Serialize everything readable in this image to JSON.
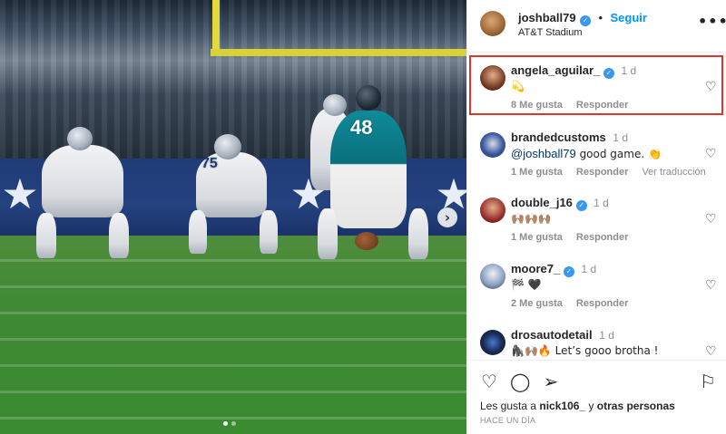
{
  "post": {
    "author": "joshball79",
    "follow_label": "Seguir",
    "location": "AT&T Stadium",
    "more_icon": "more-icon",
    "photo": {
      "description_jersey_numbers": [
        "75",
        "48"
      ],
      "carousel_index": 1,
      "carousel_total": 2
    }
  },
  "comments": [
    {
      "user": "angela_aguilar_",
      "verified": true,
      "time": "1 d",
      "text": "💫",
      "likes": "8 Me gusta",
      "reply": "Responder",
      "translate": "",
      "highlighted": true
    },
    {
      "user": "brandedcustoms",
      "verified": false,
      "time": "1 d",
      "mention": "@joshball79",
      "text": " good game. 👏",
      "likes": "1 Me gusta",
      "reply": "Responder",
      "translate": "Ver traducción",
      "highlighted": false
    },
    {
      "user": "double_j16",
      "verified": true,
      "time": "1 d",
      "text": "🙌🏽🙌🏽🙌🏽",
      "likes": "1 Me gusta",
      "reply": "Responder",
      "translate": "",
      "highlighted": false
    },
    {
      "user": "moore7_",
      "verified": true,
      "time": "1 d",
      "text": "🏁 🖤",
      "likes": "2 Me gusta",
      "reply": "Responder",
      "translate": "",
      "highlighted": false
    },
    {
      "user": "drosautodetail",
      "verified": false,
      "time": "1 d",
      "text": "🦍🙌🏽🔥 Let’s gooo brotha !",
      "likes": "",
      "reply": "",
      "translate": "",
      "highlighted": false
    }
  ],
  "footer": {
    "likes_prefix": "Les gusta a ",
    "likes_user": "nick106_",
    "likes_suffix": " y ",
    "likes_others": "otras personas",
    "date": "HACE UN DÍA"
  },
  "colors": {
    "follow_blue": "#0095f6",
    "verified_blue": "#3897f0",
    "highlight_red": "#e0352b",
    "muted_gray": "#8e8e8e"
  }
}
